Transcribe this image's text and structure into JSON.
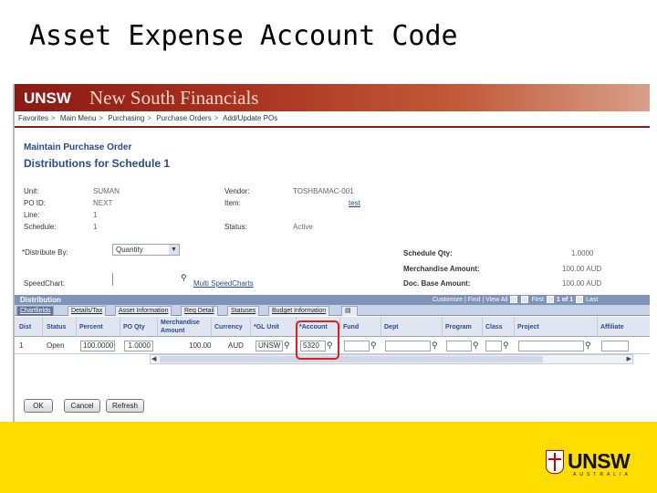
{
  "slide": {
    "title": "Asset Expense Account Code"
  },
  "app": {
    "logo": "UNSW",
    "name": "New South Financials"
  },
  "breadcrumb": [
    "Favorites",
    "Main Menu",
    "Purchasing",
    "Purchase Orders",
    "Add/Update POs"
  ],
  "page": {
    "heading": "Maintain Purchase Order",
    "title": "Distributions for Schedule 1"
  },
  "fields": {
    "unit_label": "Unit:",
    "unit": "SUMAN",
    "poid_label": "PO ID:",
    "poid": "NEXT",
    "line_label": "Line:",
    "line": "1",
    "schedule_label": "Schedule:",
    "schedule": "1",
    "vendor_label": "Vendor:",
    "vendor": "TOSHBAMAC-001",
    "item_label": "Item:",
    "item": "test",
    "status_label": "Status:",
    "status": "Active",
    "distribute_label": "*Distribute By:",
    "distribute_value": "Quantity",
    "speedchart_label": "SpeedChart:",
    "multi_speedchart": "Multi SpeedCharts",
    "sched_qty_label": "Schedule Qty:",
    "sched_qty": "1.0000",
    "merch_amt_label": "Merchandise Amount:",
    "merch_amt": "100.00 AUD",
    "doc_base_label": "Doc. Base Amount:",
    "doc_base": "100.00 AUD"
  },
  "distribution": {
    "title": "Distribution",
    "controls": {
      "customize": "Customize",
      "find": "Find",
      "view_all": "View All",
      "first": "First",
      "range": "1 of 1",
      "last": "Last"
    },
    "tabs": [
      "Chartfields",
      "Details/Tax",
      "Asset Information",
      "Req Detail",
      "Statuses",
      "Budget Information"
    ],
    "columns": [
      "Dist",
      "Status",
      "Percent",
      "PO Qty",
      "Merchandise Amount",
      "Currency",
      "*GL Unit",
      "*Account",
      "Fund",
      "Dept",
      "Program",
      "Class",
      "Project",
      "Affiliate"
    ],
    "row": {
      "dist": "1",
      "status": "Open",
      "percent": "100.0000",
      "po_qty": "1.0000",
      "merch_amount": "100.00",
      "currency": "AUD",
      "gl_unit": "UNSW",
      "account": "5320"
    }
  },
  "buttons": {
    "ok": "OK",
    "cancel": "Cancel",
    "refresh": "Refresh"
  },
  "footer": {
    "brand": "UNSW",
    "sub": "AUSTRALIA"
  },
  "colors": {
    "banner": "#8a1a14",
    "footer": "#ffdd00",
    "highlight": "#e02020",
    "label_blue": "#2b4a8a"
  },
  "icons": [
    "search-icon",
    "dropdown-arrow-icon",
    "crest-icon"
  ]
}
